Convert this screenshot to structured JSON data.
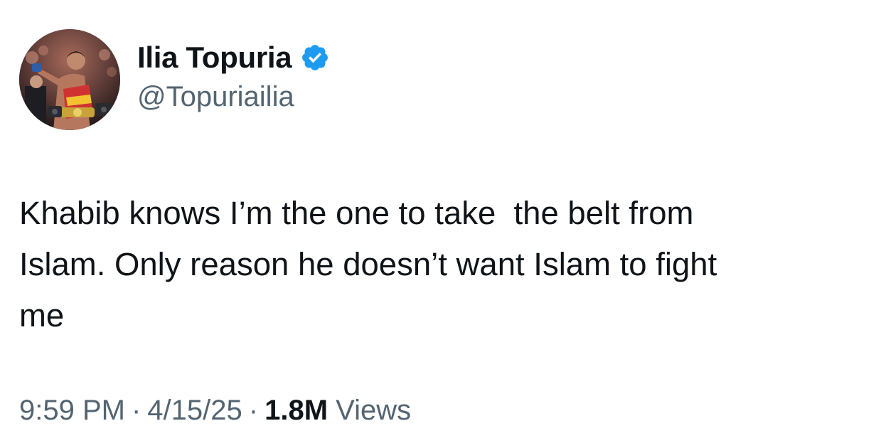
{
  "author": {
    "display_name": "Ilia Topuria",
    "handle": "@Topuriailia",
    "verified": true,
    "verified_icon": "verified-badge-icon",
    "verified_color": "#1d9bf0"
  },
  "tweet": {
    "lines": [
      "Khabib knows I’m the one to take  the belt from",
      "Islam. Only reason he doesn’t want Islam to fight",
      "me"
    ]
  },
  "meta": {
    "time": "9:59 PM",
    "separator": "·",
    "date": "4/15/25",
    "views_count": "1.8M",
    "views_label": "Views"
  },
  "colors": {
    "text_primary": "#0f1419",
    "text_secondary": "#536471",
    "accent": "#1d9bf0",
    "background": "#ffffff"
  }
}
